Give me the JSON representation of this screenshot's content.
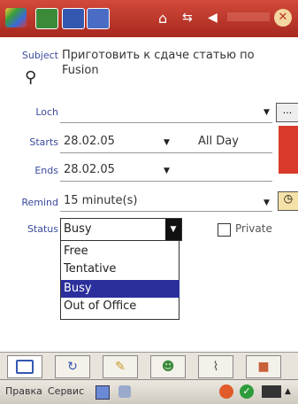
{
  "titlebar": {
    "icons": [
      "windows-logo-icon",
      "calendar-icon",
      "tasks-icon",
      "home-icon",
      "network-icon",
      "volume-icon",
      "clock-icon",
      "close-icon"
    ],
    "accent": "#b53428"
  },
  "form": {
    "subject_label": "Subject",
    "subject_value_line1": "Приготовить к сдаче статью по",
    "subject_value_line2": "Fusion",
    "loc_label": "Loch",
    "loc_button": "...",
    "starts_label": "Starts",
    "starts_date": "28.02.05",
    "all_day": "All Day",
    "ends_label": "Ends",
    "ends_date": "28.02.05",
    "remind_label": "Remind",
    "remind_value": "15 minute(s)",
    "status_label": "Status",
    "status_value": "Busy",
    "private_label": "Private",
    "status_options": [
      "Free",
      "Tentative",
      "Busy",
      "Out of Office"
    ],
    "selected_option": "Busy"
  },
  "tabs": [
    "appointment-tab",
    "recurrence-tab",
    "notes-tab",
    "attendees-tab",
    "attachments-tab",
    "categories-tab"
  ],
  "menubar": {
    "item1": "Правка",
    "item2": "Сервис"
  }
}
